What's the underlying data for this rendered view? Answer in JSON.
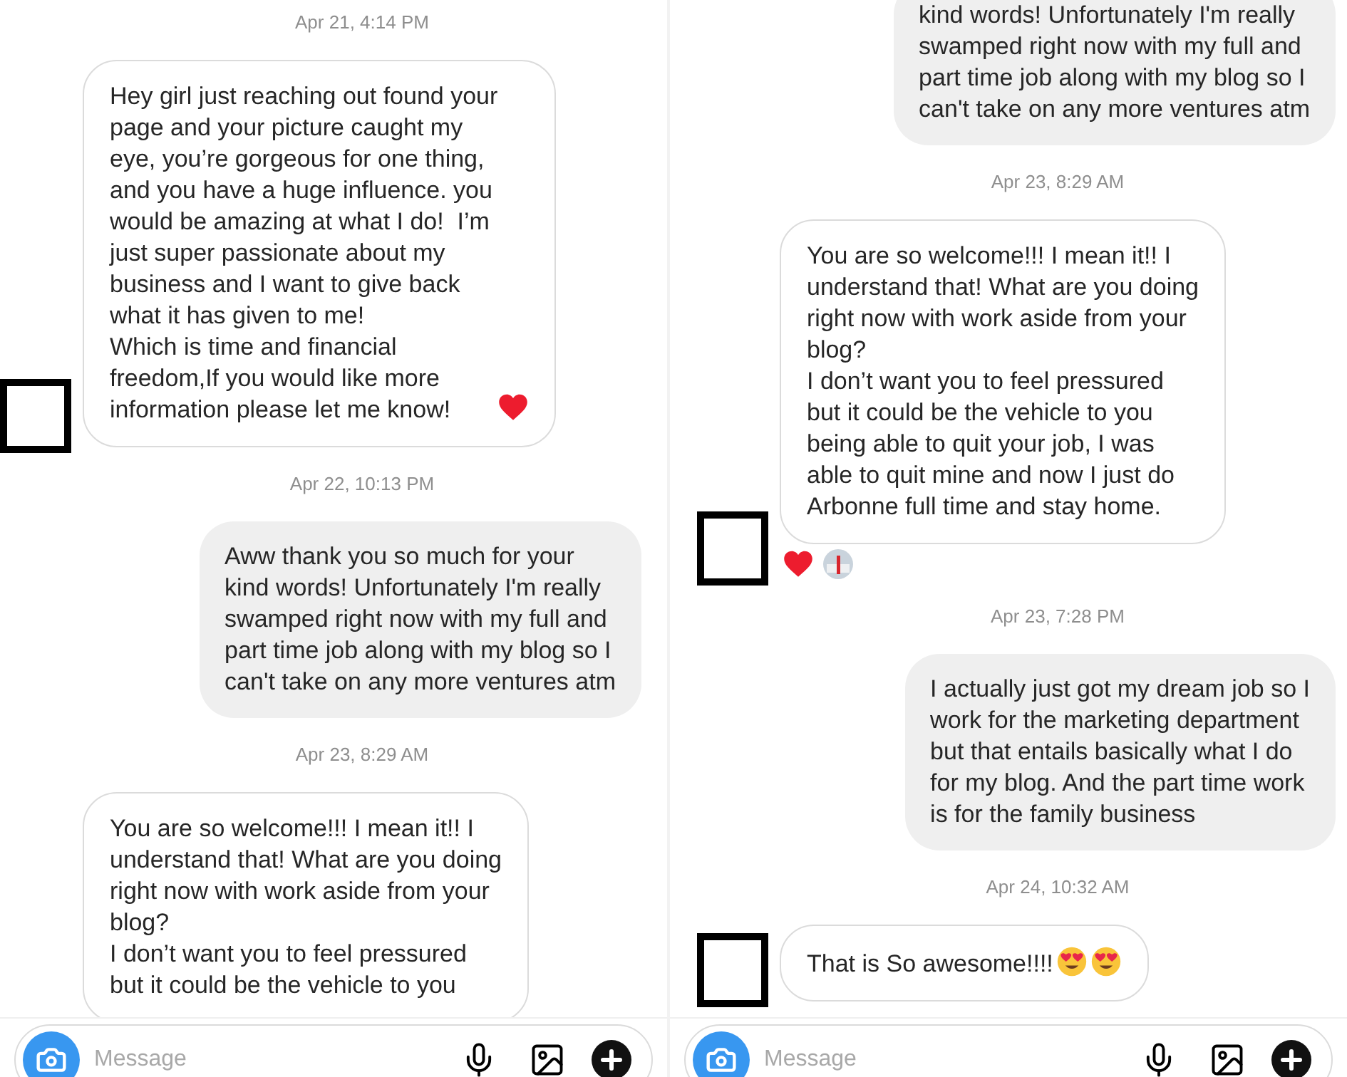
{
  "panels": [
    {
      "items": [
        {
          "kind": "timestamp",
          "text": "Apr 21, 4:14 PM"
        },
        {
          "kind": "incoming",
          "avatar_shown": true,
          "text": "Hey girl just reaching out found your\npage and your picture caught my\neye, you’re gorgeous for one thing,\nand you have a huge influence. you\nwould be amazing at what I do!  I’m\njust super passionate about my\nbusiness and I want to give back\nwhat it has given to me!\nWhich is time and financial\nfreedom,If you would like more\ninformation please let me know!",
          "emoji": [
            {
              "kind": "heart"
            }
          ]
        },
        {
          "kind": "timestamp",
          "text": "Apr 22, 10:13 PM"
        },
        {
          "kind": "outgoing",
          "text": "Aww thank you so much for your\nkind words! Unfortunately I'm really\nswamped right now with my full and\npart time job along with my blog so I\ncan't take on any more ventures atm"
        },
        {
          "kind": "timestamp",
          "text": "Apr 23, 8:29 AM"
        },
        {
          "kind": "incoming",
          "avatar_shown": false,
          "text": "You are so welcome!!! I mean it!! I\nunderstand that! What are you doing\nright now with work aside from your\nblog?\nI don’t want you to feel pressured\nbut it could be the vehicle to you"
        }
      ],
      "composer": {
        "placeholder": "Message"
      }
    },
    {
      "items": [
        {
          "kind": "outgoing",
          "text": "kind words! Unfortunately I'm really\nswamped right now with my full and\npart time job along with my blog so I\ncan't take on any more ventures atm"
        },
        {
          "kind": "timestamp",
          "text": "Apr 23, 8:29 AM"
        },
        {
          "kind": "incoming",
          "avatar_shown": true,
          "text": "You are so welcome!!! I mean it!! I\nunderstand that! What are you doing\nright now with work aside from your\nblog?\nI don’t want you to feel pressured\nbut it could be the vehicle to you\nbeing able to quit your job, I was\nable to quit mine and now I just do\nArbonne full time and stay home.",
          "reactions": [
            {
              "kind": "heart"
            },
            {
              "kind": "avatar"
            }
          ]
        },
        {
          "kind": "timestamp",
          "text": "Apr 23, 7:28 PM"
        },
        {
          "kind": "outgoing",
          "text": "I actually just got my dream job so I\nwork for the marketing department\nbut that entails basically what I do\nfor my blog. And the part time work\nis for the family business"
        },
        {
          "kind": "timestamp",
          "text": "Apr 24, 10:32 AM"
        },
        {
          "kind": "incoming",
          "avatar_shown": true,
          "text": "That is So awesome!!!!",
          "emoji": [
            {
              "kind": "heart-eyes"
            },
            {
              "kind": "heart-eyes"
            }
          ]
        }
      ],
      "composer": {
        "placeholder": "Message"
      }
    }
  ]
}
